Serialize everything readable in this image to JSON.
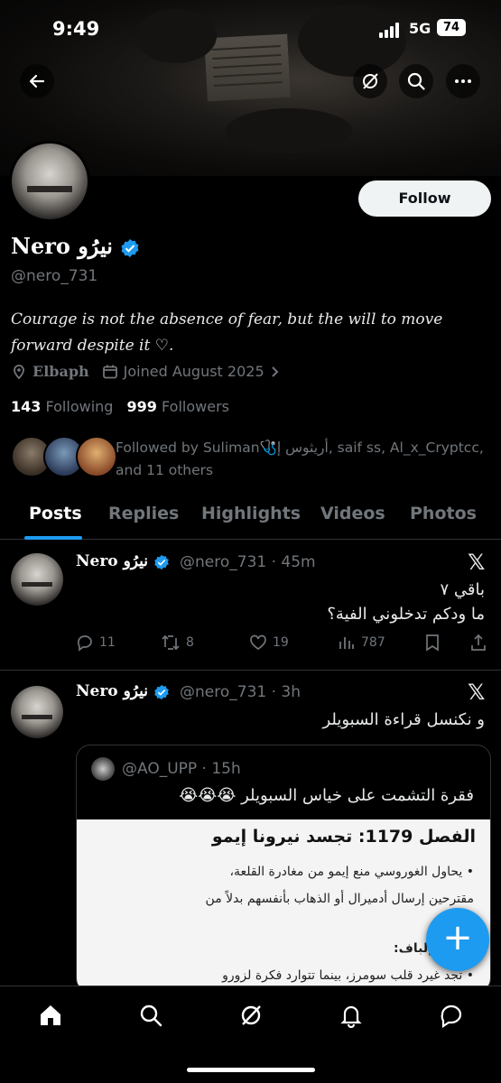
{
  "status": {
    "time": "9:49",
    "network": "5G",
    "battery": "74"
  },
  "profile": {
    "name": "Nero نيرُو",
    "handle": "@nero_731",
    "follow_label": "Follow",
    "bio": "Courage is not the absence of  fear, but the will to move forward despite it ♡.",
    "location": "Elbaph",
    "joined": "Joined August 2025",
    "following_count": "143",
    "following_label": "Following",
    "followers_count": "999",
    "followers_label": "Followers",
    "followed_by": "Followed by Suliman🩺أريثوس إ, saif ss, Al_x_Cryptcc, and 11 others"
  },
  "tabs": [
    "Posts",
    "Replies",
    "Highlights",
    "Videos",
    "Photos"
  ],
  "posts": [
    {
      "name": "Nero نيرُو",
      "meta": "@nero_731 · 45m",
      "text_line1": "باقي ٧",
      "text_line2": "ما ودكم تدخلوني الفية؟",
      "replies": "11",
      "reposts": "8",
      "likes": "19",
      "views": "787"
    },
    {
      "name": "Nero نيرُو",
      "meta": "@nero_731 · 3h",
      "text_line1": "و نكنسل قراءة السبويلر",
      "quote": {
        "meta": "@AO_UPP · 15h",
        "text": "فقرة التشمت على خياس السبويلر 😭😭😭",
        "image_title": "الفصل 1179: تجسد نيرونا إيمو",
        "image_lines": [
          "• يحاول الغوروسي منع إيمو من مغادرة القلعة،",
          "مقترحين إرسال أدميرال أو الذهاب بأنفسهم بدلاً من",
          "ل إلى إلباف:",
          "• تجد غيرد قلب سومرز، بينما تتوارد فكرة لزورو"
        ]
      }
    }
  ],
  "colors": {
    "accent": "#1d9bf0",
    "background": "#000000",
    "muted": "#71767b"
  }
}
